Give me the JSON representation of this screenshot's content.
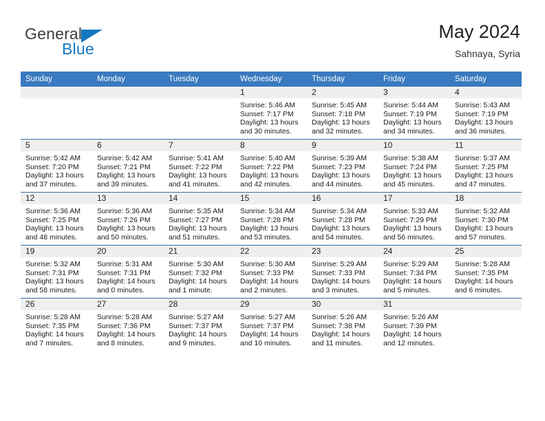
{
  "brand": {
    "name_top": "General",
    "name_bottom": "Blue",
    "triangle_color": "#1277bf"
  },
  "header": {
    "title": "May 2024",
    "subtitle": "Sahnaya, Syria"
  },
  "colors": {
    "header_blue": "#3a7ac0",
    "row_divider": "#2e6da8",
    "daynum_band": "#efefef"
  },
  "weekdays": [
    "Sunday",
    "Monday",
    "Tuesday",
    "Wednesday",
    "Thursday",
    "Friday",
    "Saturday"
  ],
  "labels": {
    "sunrise_prefix": "Sunrise:",
    "sunset_prefix": "Sunset:",
    "daylight_prefix": "Daylight:"
  },
  "weeks": [
    [
      {
        "day": "",
        "sunrise": "",
        "sunset": "",
        "daylight_line1": "",
        "daylight_line2": ""
      },
      {
        "day": "",
        "sunrise": "",
        "sunset": "",
        "daylight_line1": "",
        "daylight_line2": ""
      },
      {
        "day": "",
        "sunrise": "",
        "sunset": "",
        "daylight_line1": "",
        "daylight_line2": ""
      },
      {
        "day": "1",
        "sunrise": "Sunrise: 5:46 AM",
        "sunset": "Sunset: 7:17 PM",
        "daylight_line1": "Daylight: 13 hours",
        "daylight_line2": "and 30 minutes."
      },
      {
        "day": "2",
        "sunrise": "Sunrise: 5:45 AM",
        "sunset": "Sunset: 7:18 PM",
        "daylight_line1": "Daylight: 13 hours",
        "daylight_line2": "and 32 minutes."
      },
      {
        "day": "3",
        "sunrise": "Sunrise: 5:44 AM",
        "sunset": "Sunset: 7:19 PM",
        "daylight_line1": "Daylight: 13 hours",
        "daylight_line2": "and 34 minutes."
      },
      {
        "day": "4",
        "sunrise": "Sunrise: 5:43 AM",
        "sunset": "Sunset: 7:19 PM",
        "daylight_line1": "Daylight: 13 hours",
        "daylight_line2": "and 36 minutes."
      }
    ],
    [
      {
        "day": "5",
        "sunrise": "Sunrise: 5:42 AM",
        "sunset": "Sunset: 7:20 PM",
        "daylight_line1": "Daylight: 13 hours",
        "daylight_line2": "and 37 minutes."
      },
      {
        "day": "6",
        "sunrise": "Sunrise: 5:42 AM",
        "sunset": "Sunset: 7:21 PM",
        "daylight_line1": "Daylight: 13 hours",
        "daylight_line2": "and 39 minutes."
      },
      {
        "day": "7",
        "sunrise": "Sunrise: 5:41 AM",
        "sunset": "Sunset: 7:22 PM",
        "daylight_line1": "Daylight: 13 hours",
        "daylight_line2": "and 41 minutes."
      },
      {
        "day": "8",
        "sunrise": "Sunrise: 5:40 AM",
        "sunset": "Sunset: 7:22 PM",
        "daylight_line1": "Daylight: 13 hours",
        "daylight_line2": "and 42 minutes."
      },
      {
        "day": "9",
        "sunrise": "Sunrise: 5:39 AM",
        "sunset": "Sunset: 7:23 PM",
        "daylight_line1": "Daylight: 13 hours",
        "daylight_line2": "and 44 minutes."
      },
      {
        "day": "10",
        "sunrise": "Sunrise: 5:38 AM",
        "sunset": "Sunset: 7:24 PM",
        "daylight_line1": "Daylight: 13 hours",
        "daylight_line2": "and 45 minutes."
      },
      {
        "day": "11",
        "sunrise": "Sunrise: 5:37 AM",
        "sunset": "Sunset: 7:25 PM",
        "daylight_line1": "Daylight: 13 hours",
        "daylight_line2": "and 47 minutes."
      }
    ],
    [
      {
        "day": "12",
        "sunrise": "Sunrise: 5:36 AM",
        "sunset": "Sunset: 7:25 PM",
        "daylight_line1": "Daylight: 13 hours",
        "daylight_line2": "and 48 minutes."
      },
      {
        "day": "13",
        "sunrise": "Sunrise: 5:36 AM",
        "sunset": "Sunset: 7:26 PM",
        "daylight_line1": "Daylight: 13 hours",
        "daylight_line2": "and 50 minutes."
      },
      {
        "day": "14",
        "sunrise": "Sunrise: 5:35 AM",
        "sunset": "Sunset: 7:27 PM",
        "daylight_line1": "Daylight: 13 hours",
        "daylight_line2": "and 51 minutes."
      },
      {
        "day": "15",
        "sunrise": "Sunrise: 5:34 AM",
        "sunset": "Sunset: 7:28 PM",
        "daylight_line1": "Daylight: 13 hours",
        "daylight_line2": "and 53 minutes."
      },
      {
        "day": "16",
        "sunrise": "Sunrise: 5:34 AM",
        "sunset": "Sunset: 7:28 PM",
        "daylight_line1": "Daylight: 13 hours",
        "daylight_line2": "and 54 minutes."
      },
      {
        "day": "17",
        "sunrise": "Sunrise: 5:33 AM",
        "sunset": "Sunset: 7:29 PM",
        "daylight_line1": "Daylight: 13 hours",
        "daylight_line2": "and 56 minutes."
      },
      {
        "day": "18",
        "sunrise": "Sunrise: 5:32 AM",
        "sunset": "Sunset: 7:30 PM",
        "daylight_line1": "Daylight: 13 hours",
        "daylight_line2": "and 57 minutes."
      }
    ],
    [
      {
        "day": "19",
        "sunrise": "Sunrise: 5:32 AM",
        "sunset": "Sunset: 7:31 PM",
        "daylight_line1": "Daylight: 13 hours",
        "daylight_line2": "and 58 minutes."
      },
      {
        "day": "20",
        "sunrise": "Sunrise: 5:31 AM",
        "sunset": "Sunset: 7:31 PM",
        "daylight_line1": "Daylight: 14 hours",
        "daylight_line2": "and 0 minutes."
      },
      {
        "day": "21",
        "sunrise": "Sunrise: 5:30 AM",
        "sunset": "Sunset: 7:32 PM",
        "daylight_line1": "Daylight: 14 hours",
        "daylight_line2": "and 1 minute."
      },
      {
        "day": "22",
        "sunrise": "Sunrise: 5:30 AM",
        "sunset": "Sunset: 7:33 PM",
        "daylight_line1": "Daylight: 14 hours",
        "daylight_line2": "and 2 minutes."
      },
      {
        "day": "23",
        "sunrise": "Sunrise: 5:29 AM",
        "sunset": "Sunset: 7:33 PM",
        "daylight_line1": "Daylight: 14 hours",
        "daylight_line2": "and 3 minutes."
      },
      {
        "day": "24",
        "sunrise": "Sunrise: 5:29 AM",
        "sunset": "Sunset: 7:34 PM",
        "daylight_line1": "Daylight: 14 hours",
        "daylight_line2": "and 5 minutes."
      },
      {
        "day": "25",
        "sunrise": "Sunrise: 5:28 AM",
        "sunset": "Sunset: 7:35 PM",
        "daylight_line1": "Daylight: 14 hours",
        "daylight_line2": "and 6 minutes."
      }
    ],
    [
      {
        "day": "26",
        "sunrise": "Sunrise: 5:28 AM",
        "sunset": "Sunset: 7:35 PM",
        "daylight_line1": "Daylight: 14 hours",
        "daylight_line2": "and 7 minutes."
      },
      {
        "day": "27",
        "sunrise": "Sunrise: 5:28 AM",
        "sunset": "Sunset: 7:36 PM",
        "daylight_line1": "Daylight: 14 hours",
        "daylight_line2": "and 8 minutes."
      },
      {
        "day": "28",
        "sunrise": "Sunrise: 5:27 AM",
        "sunset": "Sunset: 7:37 PM",
        "daylight_line1": "Daylight: 14 hours",
        "daylight_line2": "and 9 minutes."
      },
      {
        "day": "29",
        "sunrise": "Sunrise: 5:27 AM",
        "sunset": "Sunset: 7:37 PM",
        "daylight_line1": "Daylight: 14 hours",
        "daylight_line2": "and 10 minutes."
      },
      {
        "day": "30",
        "sunrise": "Sunrise: 5:26 AM",
        "sunset": "Sunset: 7:38 PM",
        "daylight_line1": "Daylight: 14 hours",
        "daylight_line2": "and 11 minutes."
      },
      {
        "day": "31",
        "sunrise": "Sunrise: 5:26 AM",
        "sunset": "Sunset: 7:39 PM",
        "daylight_line1": "Daylight: 14 hours",
        "daylight_line2": "and 12 minutes."
      },
      {
        "day": "",
        "sunrise": "",
        "sunset": "",
        "daylight_line1": "",
        "daylight_line2": ""
      }
    ]
  ]
}
